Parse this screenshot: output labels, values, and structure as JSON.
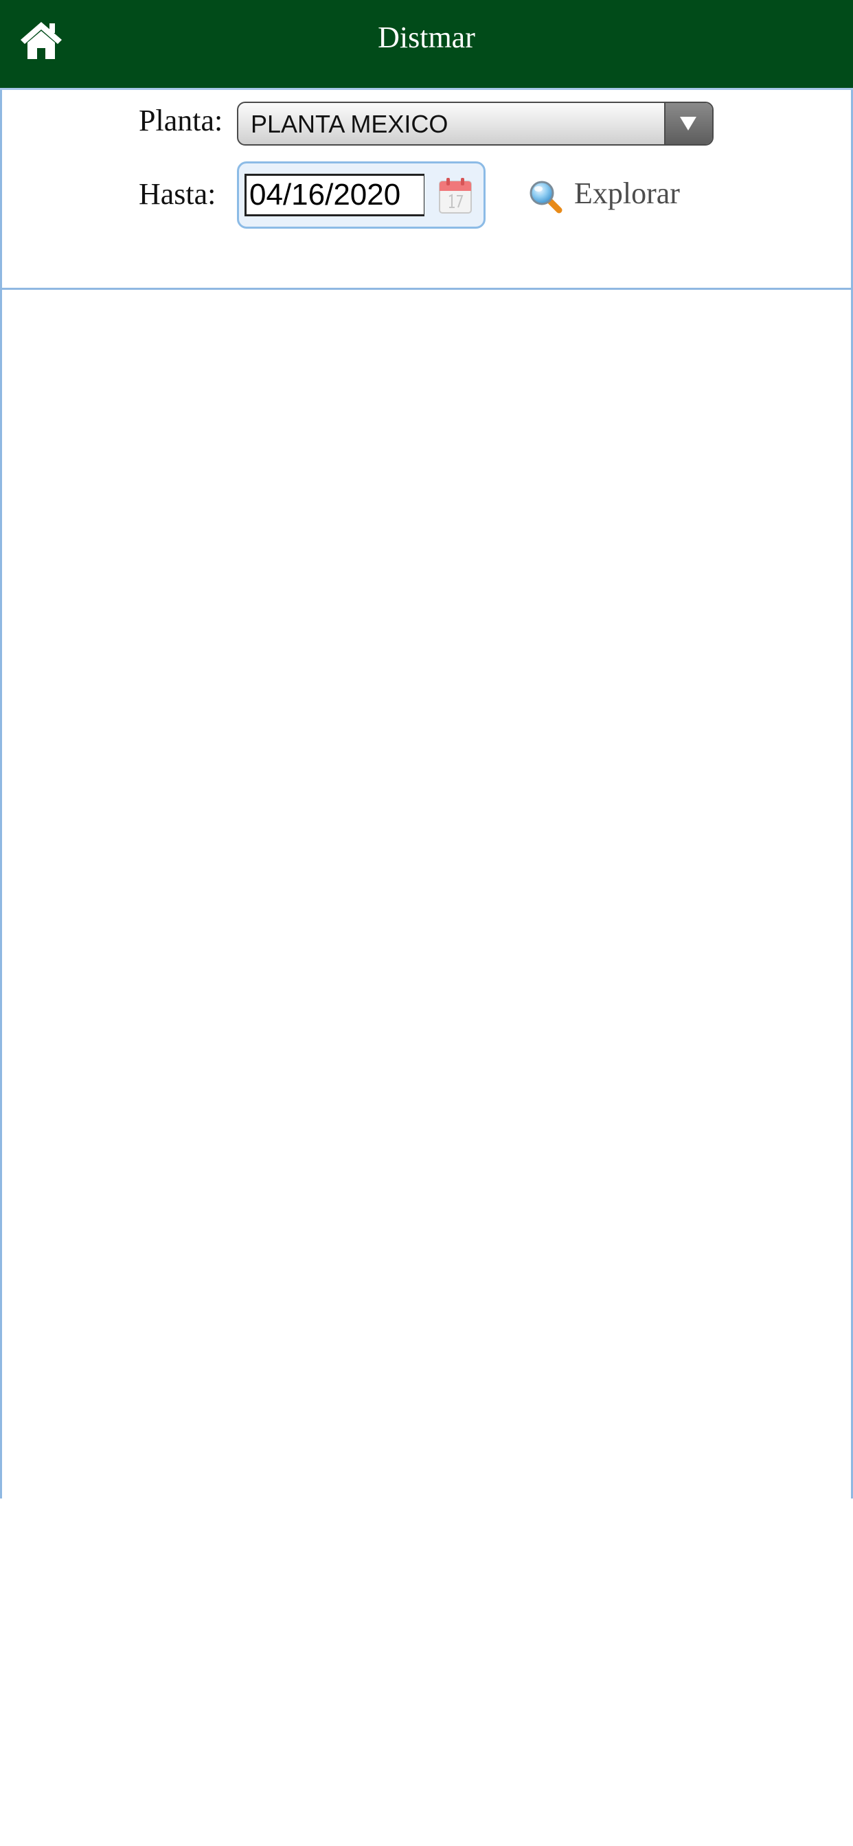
{
  "header": {
    "title": "Distmar",
    "home_icon": "home-icon",
    "background": "#014b19"
  },
  "filters": {
    "planta_label": "Planta:",
    "planta_selected": "PLANTA MEXICO",
    "hasta_label": "Hasta:",
    "hasta_value": "04/16/2020",
    "calendar_icon": "calendar-icon",
    "explorar_label": "Explorar",
    "explorar_icon": "magnifier-icon"
  },
  "colors": {
    "header_bg": "#014b19",
    "panel_border": "#8fb8e2"
  }
}
